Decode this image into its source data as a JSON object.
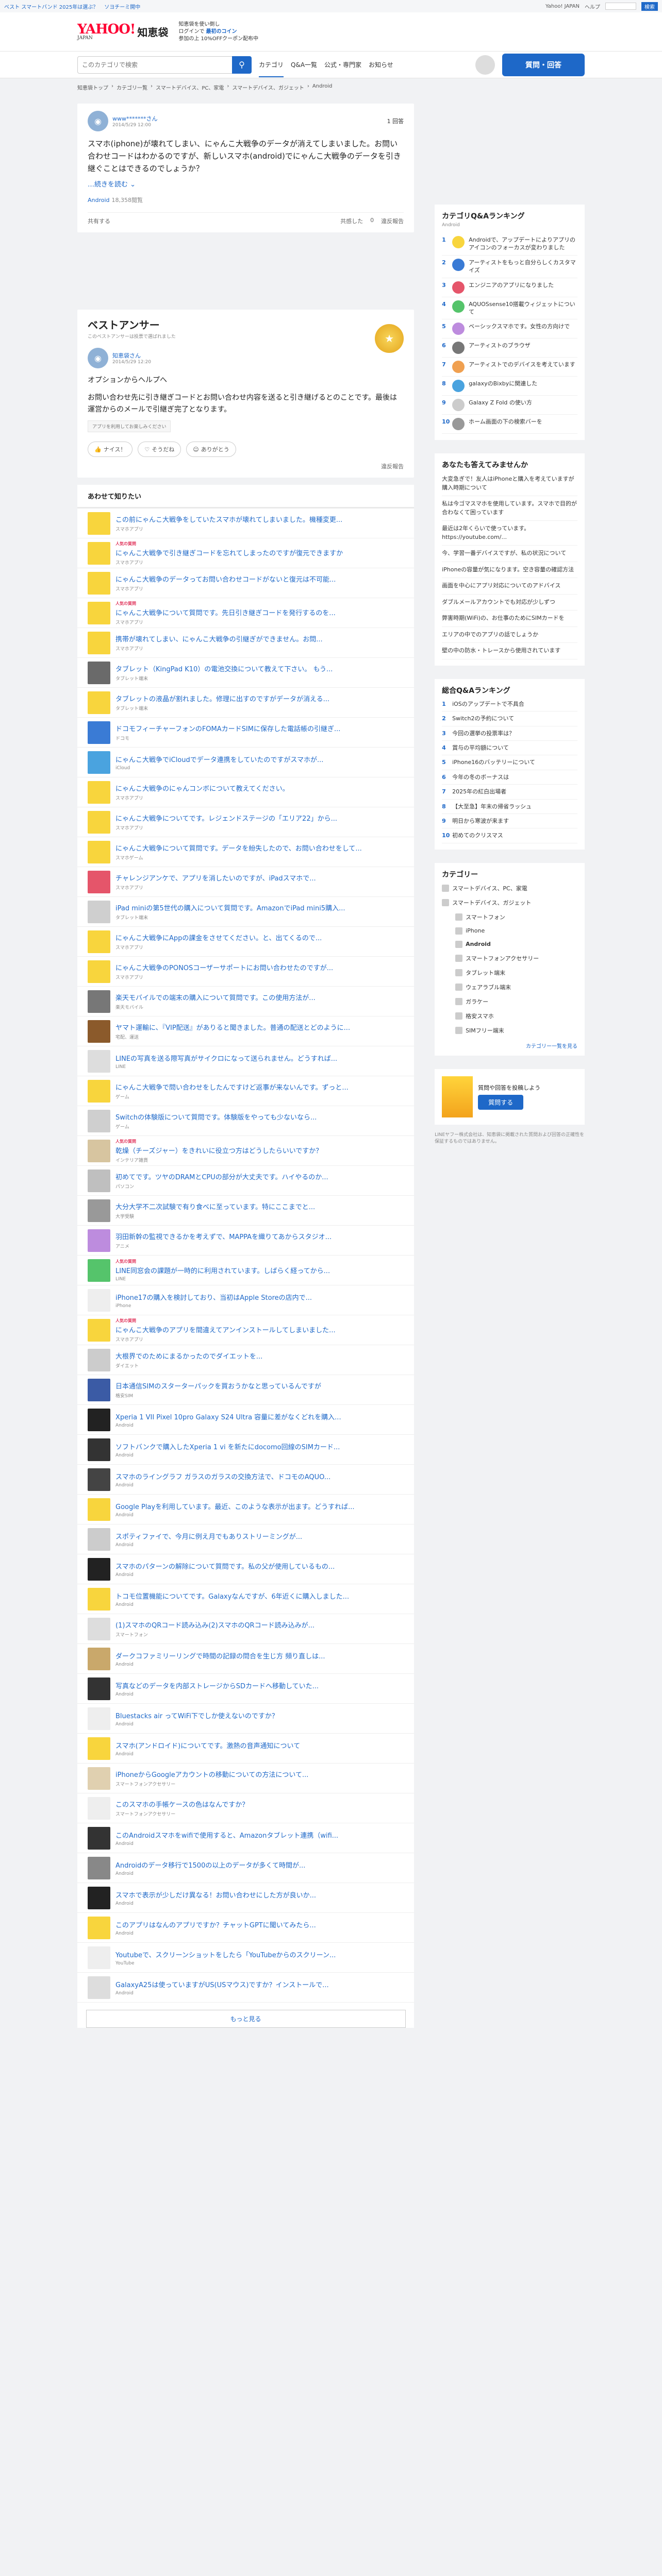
{
  "topbar": {
    "links": [
      "ベスト スマートバンド 2025年は選ぶ？",
      "ソヨチーミ開中"
    ],
    "right": [
      "Yahoo! JAPAN",
      "ヘルプ"
    ]
  },
  "header": {
    "logo": "YAHOO!",
    "logo_sub": "JAPAN",
    "service": "知恵袋",
    "promo_line1": "知恵袋を使い倒し",
    "promo_line2": "ログインで",
    "promo_link": "最初のコイン",
    "promo_tail": "参加の上 10%OFFクーポン配布中"
  },
  "nav": {
    "search_placeholder": "このカテゴリで検索",
    "links": [
      "カテゴリ",
      "Q&A一覧",
      "公式・専門家",
      "お知らせ"
    ],
    "post_button": "質問・回答"
  },
  "breadcrumb": [
    "知恵袋トップ",
    "カテゴリ一覧",
    "スマートデバイス、PC、家電",
    "スマートデバイス、ガジェット",
    "Android"
  ],
  "question": {
    "user": "www*******さん",
    "date": "2014/5/29 12:00",
    "views": "1 回答",
    "body": "スマホ(iphone)が壊れてしまい、にゃんこ大戦争のデータが消えてしまいました。お問い合わせコードはわかるのですが、新しいスマホ(android)でにゃんこ大戦争のデータを引き継ぐことはできるのでしょうか？",
    "more": "…続きを読む ⌄",
    "tag": "Android",
    "tag_views": "18,358閲覧",
    "share_count": "共有する",
    "opts": [
      "共感した",
      "0",
      "違反報告"
    ]
  },
  "best": {
    "title": "ベストアンサー",
    "sub": "このベストアンサーは投票で選ばれました",
    "user": "知恵袋さん",
    "date": "2014/5/29 12:20",
    "body1": "オプションからヘルプへ",
    "body2": "お問い合わせ先に引き継ぎコードとお問い合わせ内容を送ると引き継げるとのことです。最後は運営からのメールで引継ぎ完了となります。",
    "notice": "アプリを利用してお楽しみください",
    "reactions": [
      "ナイス！",
      "そうだね",
      "ありがとう"
    ],
    "report": "違反報告"
  },
  "related": {
    "title": "あわせて知りたい",
    "hot_label": "人気の質問",
    "more_button": "もっと見る",
    "rows": [
      {
        "title": "この前にゃんこ大戦争をしていたスマホが壊れてしまいました。機種変更...",
        "cat": "スマホアプリ",
        "hot": false,
        "c": "#f8d53d"
      },
      {
        "title": "にゃんこ大戦争で引き継ぎコードを忘れてしまったのですが復元できますか",
        "cat": "スマホアプリ",
        "hot": true,
        "c": "#f8d53d"
      },
      {
        "title": "にゃんこ大戦争のデータってお問い合わせコードがないと復元は不可能...",
        "cat": "スマホアプリ",
        "hot": false,
        "c": "#f8d53d"
      },
      {
        "title": "にゃんこ大戦争について質問です。先日引き継ぎコードを発行するのを...",
        "cat": "スマホアプリ",
        "hot": true,
        "c": "#f8d53d"
      },
      {
        "title": "携帯が壊れてしまい、にゃんこ大戦争の引継ぎができません。お問...",
        "cat": "スマホアプリ",
        "hot": false,
        "c": "#f8d53d"
      },
      {
        "title": "タブレット（KingPad K10）の電池交換について教えて下さい。 もう...",
        "cat": "タブレット端末",
        "hot": false,
        "c": "#6a6a6a"
      },
      {
        "title": "タブレットの液晶が割れました。修理に出すのですがデータが消える...",
        "cat": "タブレット端末",
        "hot": false,
        "c": "#f8d53d"
      },
      {
        "title": "ドコモフィーチャーフォンのFOMAカードSIMに保存した電話帳の引継ぎ...",
        "cat": "ドコモ",
        "hot": false,
        "c": "#3a7bd5"
      },
      {
        "title": "にゃんこ大戦争でiCloudでデータ連携をしていたのですがスマホが...",
        "cat": "iCloud",
        "hot": false,
        "c": "#4aa3df"
      },
      {
        "title": "にゃんこ大戦争のにゃんコンボについて教えてください。",
        "cat": "スマホアプリ",
        "hot": false,
        "c": "#f8d53d"
      },
      {
        "title": "にゃんこ大戦争についてです。レジェンドステージの「エリア22」から...",
        "cat": "スマホアプリ",
        "hot": false,
        "c": "#f8d53d"
      },
      {
        "title": "にゃんこ大戦争について質問です。データを紛失したので、お問い合わせをして...",
        "cat": "スマホゲーム",
        "hot": false,
        "c": "#f8d53d"
      },
      {
        "title": "チャレンジアンケで、アプリを消したいのですが、iPadスマホで...",
        "cat": "スマホアプリ",
        "hot": false,
        "c": "#e5556a"
      },
      {
        "title": "iPad miniの第5世代の購入について質問です。AmazonでiPad mini5購入...",
        "cat": "タブレット端末",
        "hot": false,
        "c": "#cfcfcf"
      },
      {
        "title": "にゃんこ大戦争にAppの課金をさせてください。と、出てくるので...",
        "cat": "スマホアプリ",
        "hot": false,
        "c": "#f8d53d"
      },
      {
        "title": "にゃんこ大戦争のPONOSコーザーサポートにお問い合わせたのですが...",
        "cat": "スマホアプリ",
        "hot": false,
        "c": "#f8d53d"
      },
      {
        "title": "楽天モバイルでの端末の購入について質問です。この使用方法が...",
        "cat": "楽天モバイル",
        "hot": false,
        "c": "#777777"
      },
      {
        "title": "ヤマト運輸に、『VIP配送』がありると聞きました。普通の配送とどのように...",
        "cat": "宅配、運送",
        "hot": false,
        "c": "#8b5a2b"
      },
      {
        "title": "LINEの写真を送る際写真がサイクロになって送られません。どうすれば...",
        "cat": "LINE",
        "hot": false,
        "c": "#dddddd"
      },
      {
        "title": "にゃんこ大戦争で問い合わせをしたんですけど返事が来ないんです。ずっと...",
        "cat": "ゲーム",
        "hot": false,
        "c": "#f8d53d"
      },
      {
        "title": "Switchの体験版について質問です。体験版をやっても少ないなら...",
        "cat": "ゲーム",
        "hot": false,
        "c": "#cfcfcf"
      },
      {
        "title": "乾燥（チーズジャー）をきれいに役立つ方はどうしたらいいですか？",
        "cat": "インテリア雑貨",
        "hot": true,
        "c": "#d7c5a0"
      },
      {
        "title": "初めてです。ツヤのDRAMとCPUの部分が大丈夫です。ハイやるのか...",
        "cat": "パソコン",
        "hot": false,
        "c": "#bfbfbf"
      },
      {
        "title": "大分大学不二次試験で有り食べに至っています。特にここまでと...",
        "cat": "大学受験",
        "hot": false,
        "c": "#999999"
      },
      {
        "title": "羽田新幹の監視できるかを考えずで、MAPPAを織りてあからスタジオ...",
        "cat": "アニメ",
        "hot": false,
        "c": "#bd8cde"
      },
      {
        "title": "LINE同窓会の課題が一時的に利用されています。しばらく経ってから...",
        "cat": "LINE",
        "hot": true,
        "c": "#55c46b"
      },
      {
        "title": "iPhone17の購入を検討しており、当初はApple Storeの店内で...",
        "cat": "iPhone",
        "hot": false,
        "c": "#eeeeee"
      },
      {
        "title": "にゃんこ大戦争のアプリを間違えてアンインストールしてしまいました...",
        "cat": "スマホアプリ",
        "hot": true,
        "c": "#f8d53d"
      },
      {
        "title": "大根界でのためにまるかったのでダイエットを...",
        "cat": "ダイエット",
        "hot": false,
        "c": "#cccccc"
      },
      {
        "title": "日本通信SIMのスターターパックを買おうかなと思っているんですが",
        "cat": "格安SIM",
        "hot": false,
        "c": "#3b5ba5"
      },
      {
        "title": "Xperia 1 VII Pixel 10pro Galaxy S24 Ultra 容量に差がなくどれを購入...",
        "cat": "Android",
        "hot": false,
        "c": "#222222"
      },
      {
        "title": "ソフトバンクで購入したXperia 1 vi を新たにdocomo回線のSIMカード...",
        "cat": "Android",
        "hot": false,
        "c": "#333333"
      },
      {
        "title": "スマホのライングラフ ガラスのガラスの交換方法で、ドコモのAQUO...",
        "cat": "Android",
        "hot": false,
        "c": "#444444"
      },
      {
        "title": "Google Playを利用しています。最近、このような表示が出ます。どうすれば...",
        "cat": "Android",
        "hot": false,
        "c": "#f8d53d"
      },
      {
        "title": "スポティファイで、今月に例え月でもありストリーミングが...",
        "cat": "Android",
        "hot": false,
        "c": "#cccccc"
      },
      {
        "title": "スマホのパターンの解除について質問です。私の父が使用しているもの...",
        "cat": "Android",
        "hot": false,
        "c": "#222222"
      },
      {
        "title": "トコモ位置機能についてです。Galaxyなんですが、6年近くに購入しました...",
        "cat": "Android",
        "hot": false,
        "c": "#f8d53d"
      },
      {
        "title": "(1)スマホのQRコード読み込み(2)スマホのQRコード読み込みが...",
        "cat": "スマートフォン",
        "hot": false,
        "c": "#dddddd"
      },
      {
        "title": "ダークコファミリーリングで時間の記録の問合を生じ方 頻り直しは...",
        "cat": "Android",
        "hot": false,
        "c": "#c9a86b"
      },
      {
        "title": "写真などのデータを内部ストレージからSDカードへ移動していた...",
        "cat": "Android",
        "hot": false,
        "c": "#333333"
      },
      {
        "title": "Bluestacks air ってWiFi下でしか使えないのですか？",
        "cat": "Android",
        "hot": false,
        "c": "#eeeeee"
      },
      {
        "title": "スマホ(アンドロイド)についてです。激熱の音声通知について",
        "cat": "Android",
        "hot": false,
        "c": "#f8d53d"
      },
      {
        "title": "iPhoneからGoogleアカウントの移動についての方法について...",
        "cat": "スマートフォンアクセサリー",
        "hot": false,
        "c": "#e0d0b0"
      },
      {
        "title": "このスマホの手帳ケースの色はなんですか？",
        "cat": "スマートフォンアクセサリー",
        "hot": false,
        "c": "#eeeeee"
      },
      {
        "title": "このAndroidスマホをwifiで使用すると、Amazonタブレット連携（wifi...",
        "cat": "Android",
        "hot": false,
        "c": "#333333"
      },
      {
        "title": "Androidのデータ移行で1500の以上のデータが多くて時間が...",
        "cat": "Android",
        "hot": false,
        "c": "#888888"
      },
      {
        "title": "スマホで表示が少しだけ異なる！お問い合わせにした方が良いか...",
        "cat": "Android",
        "hot": false,
        "c": "#222222"
      },
      {
        "title": "このアプリはなんのアプリですか？チャットGPTに聞いてみたら...",
        "cat": "Android",
        "hot": false,
        "c": "#f8d53d"
      },
      {
        "title": "Youtubeで、スクリーンショットをしたら「YouTubeからのスクリーン...",
        "cat": "YouTube",
        "hot": false,
        "c": "#eeeeee"
      },
      {
        "title": "GalaxyA25は使っていますがUS(USマウス)ですか？インストールで...",
        "cat": "Android",
        "hot": false,
        "c": "#dddddd"
      }
    ]
  },
  "side": {
    "ranking_title": "カテゴリQ&Aランキング",
    "ranking_sub": "Android",
    "ranking": [
      "Androidで、アップデートによりアプリのアイコンのフォーカスが変わりました",
      "アーティストをもっと自分らしくカスタマイズ",
      "エンジニアのアプリになりました",
      "AQUOSsense10搭載ウィジェットについて",
      "ベーシックスマホです。女性の方向けで",
      "アーティストのブラウザ",
      "アーティストでのデバイスを考えています",
      "galaxyのBixbyに関連した",
      "Galaxy Z Fold の使い方",
      "ホーム画面の下の検索バーを"
    ],
    "think_title": "あなたも答えてみませんか",
    "think": [
      "大変急ぎで！友人はiPhoneと購入を考えていますが購入時期について",
      "私は今ゴマスマホを使用しています。スマホで目的が合わなくて困っています",
      "最近は2年くらいで使っています。https://youtube.com/...",
      "今、学習一番デバイスですが、私の状況について",
      "iPhoneの容量が気になります。空き容量の確認方法",
      "画面を中心にアプリ対応についてのアドバイス",
      "ダブルメールアカウントでも対応が少しずつ",
      "弊害時期(WiFi)の、お仕事のためにSIMカードを",
      "エリアの中でのアプリの話でしょうか",
      "壁の中の防水・トレースから使用されています"
    ],
    "all_title": "総合Q&Aランキング",
    "all": [
      "iOSのアップデートで不具合",
      "Switch2の予約について",
      "今回の選挙の投票率は？",
      "賞与の平均額について",
      "iPhone16のバッテリーについて",
      "今年の冬のボーナスは",
      "2025年の紅白出場者",
      "【大至急】年末の帰省ラッシュ",
      "明日から寒波が来ます",
      "初めてのクリスマス"
    ],
    "cat_title": "カテゴリー",
    "cats": [
      {
        "t": "スマートデバイス、PC、家電",
        "l": 0
      },
      {
        "t": "スマートデバイス、ガジェット",
        "l": 0
      },
      {
        "t": "スマートフォン",
        "l": 1
      },
      {
        "t": "iPhone",
        "l": 1
      },
      {
        "t": "Android",
        "l": 1,
        "sel": true
      },
      {
        "t": "スマートフォンアクセサリー",
        "l": 1
      },
      {
        "t": "タブレット端末",
        "l": 1
      },
      {
        "t": "ウェアラブル端末",
        "l": 1
      },
      {
        "t": "ガラケー",
        "l": 1
      },
      {
        "t": "格安スマホ",
        "l": 1
      },
      {
        "t": "SIMフリー端末",
        "l": 1
      }
    ],
    "cat_more": "カテゴリー一覧を見る",
    "ad_title": "質問や回答を投稿しよう",
    "ad_button": "質問する",
    "footnote": "LINEヤフー株式会社は、知恵袋に掲載された質問および回答の正確性を保証するものではありません。"
  }
}
